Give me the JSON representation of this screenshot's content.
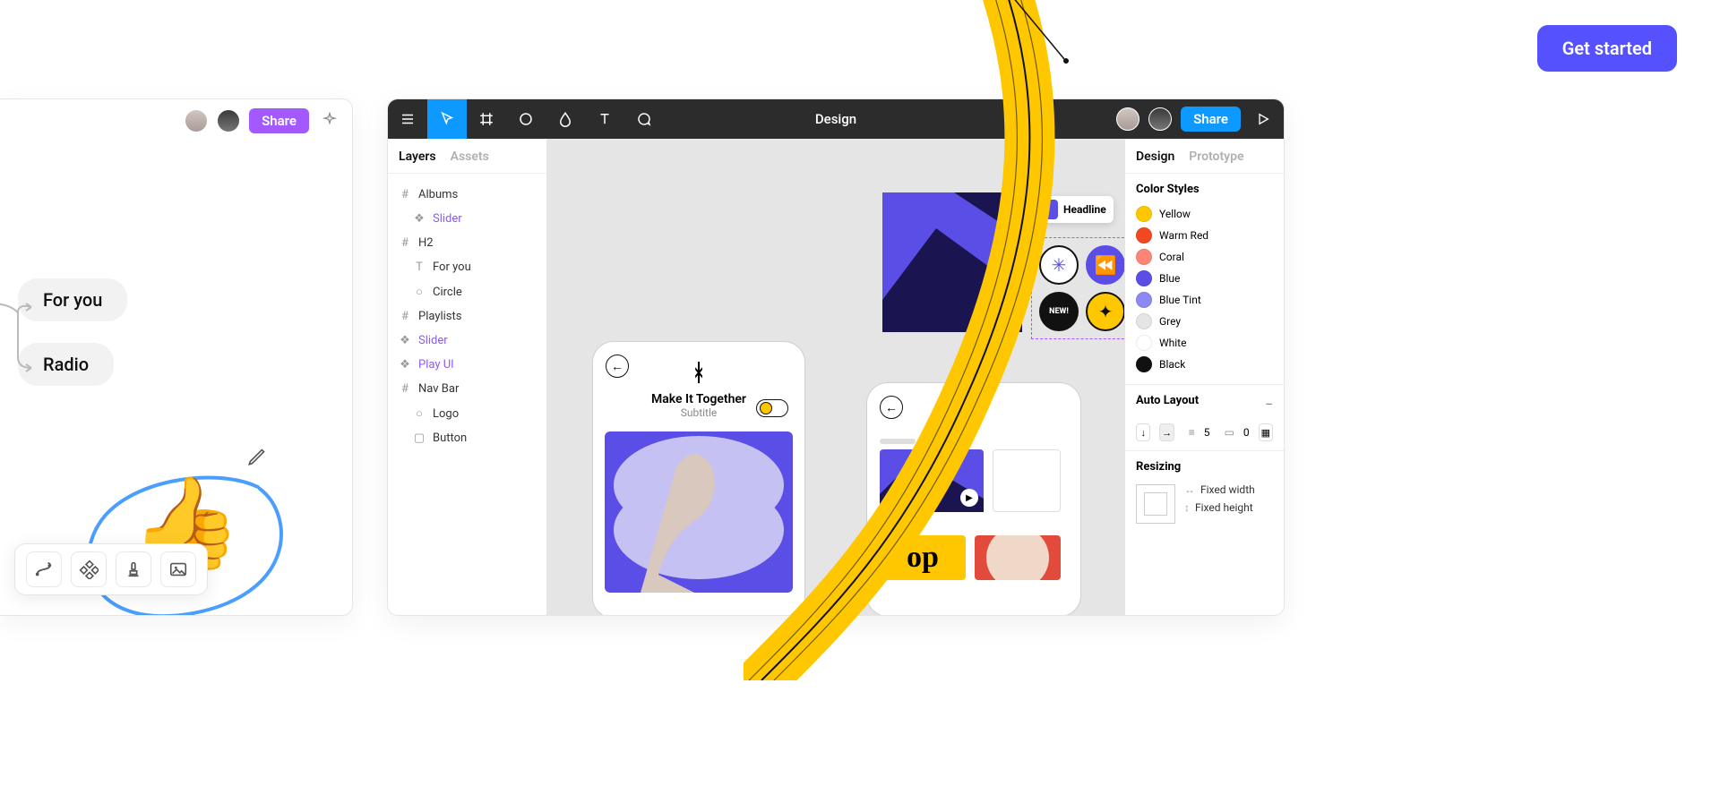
{
  "cta": {
    "get_started": "Get started"
  },
  "jam": {
    "share": "Share",
    "chips": {
      "for_you": "For you",
      "radio": "Radio"
    }
  },
  "toolbar": {
    "title": "Design",
    "share": "Share"
  },
  "panels": {
    "layers_tab": "Layers",
    "assets_tab": "Assets",
    "design_tab": "Design",
    "prototype_tab": "Prototype"
  },
  "layers": {
    "albums": "Albums",
    "slider": "Slider",
    "h2": "H2",
    "for_you": "For you",
    "circle": "Circle",
    "playlists": "Playlists",
    "slider2": "Slider",
    "play_ui": "Play UI",
    "nav_bar": "Nav Bar",
    "logo": "Logo",
    "button": "Button"
  },
  "canvas": {
    "song_title": "Make It Together",
    "song_sub": "Subtitle",
    "headline_tag": "Headline",
    "sticker_new": "NEW!"
  },
  "right": {
    "color_styles_title": "Color Styles",
    "colors": {
      "yellow": {
        "label": "Yellow",
        "hex": "#ffc700"
      },
      "warm_red": {
        "label": "Warm Red",
        "hex": "#f24822"
      },
      "coral": {
        "label": "Coral",
        "hex": "#ff8577"
      },
      "blue": {
        "label": "Blue",
        "hex": "#5b4ee6"
      },
      "blue_tint": {
        "label": "Blue Tint",
        "hex": "#8e88f5"
      },
      "grey": {
        "label": "Grey",
        "hex": "#e5e5e5"
      },
      "white": {
        "label": "White",
        "hex": "#ffffff"
      },
      "black": {
        "label": "Black",
        "hex": "#111111"
      }
    },
    "auto_layout_title": "Auto Layout",
    "gap_value": "5",
    "padding_value": "0",
    "resizing_title": "Resizing",
    "fixed_width": "Fixed width",
    "fixed_height": "Fixed height"
  }
}
